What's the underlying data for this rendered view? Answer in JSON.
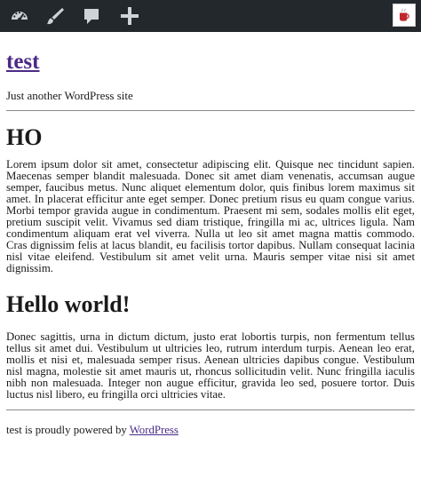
{
  "admin_bar": {
    "icons": [
      "dashboard-icon",
      "customize-brush-icon",
      "comments-icon",
      "new-content-plus-icon"
    ],
    "avatar": "user-avatar-icon",
    "background": "#23282d"
  },
  "site": {
    "title": "test",
    "tagline": "Just another WordPress site"
  },
  "posts": [
    {
      "title": "HO",
      "body": "Lorem ipsum dolor sit amet, consectetur adipiscing elit. Quisque nec tincidunt sapien. Maecenas semper blandit malesuada. Donec sit amet diam venenatis, accumsan augue semper, faucibus metus. Nunc aliquet elementum dolor, quis finibus lorem maximus sit amet. In placerat efficitur ante eget semper. Donec pretium risus eu quam congue varius. Morbi tempor gravida augue in condimentum. Praesent mi sem, sodales mollis elit eget, pretium suscipit velit. Vivamus sed diam tristique, fringilla mi ac, ultrices ligula. Nam condimentum aliquam erat vel viverra. Nulla ut leo sit amet magna mattis commodo. Cras dignissim felis at lacus blandit, eu facilisis tortor dapibus. Nullam consequat lacinia nisl vitae eleifend. Vestibulum sit amet velit urna. Mauris semper vitae nisi sit amet dignissim."
    },
    {
      "title": "Hello world!",
      "body": "Donec sagittis, urna in dictum dictum, justo erat lobortis turpis, non fermentum tellus tellus sit amet dui. Vestibulum ut ultricies leo, rutrum interdum turpis. Aenean leo erat, mollis et nisi et, malesuada semper risus. Aenean ultricies dapibus congue. Vestibulum nisl magna, molestie sit amet mauris ut, rhoncus sollicitudin velit. Nunc fringilla iaculis nibh non malesuada. Integer non augue efficitur, gravida leo sed, posuere tortor. Duis luctus nisl libero, eu fringilla orci ultricies vitae."
    }
  ],
  "footer": {
    "text": "test is proudly powered by",
    "link": "WordPress"
  },
  "colors": {
    "link": "#4b2a86",
    "text": "#1a1a1a",
    "rule": "#8a8a8a"
  }
}
